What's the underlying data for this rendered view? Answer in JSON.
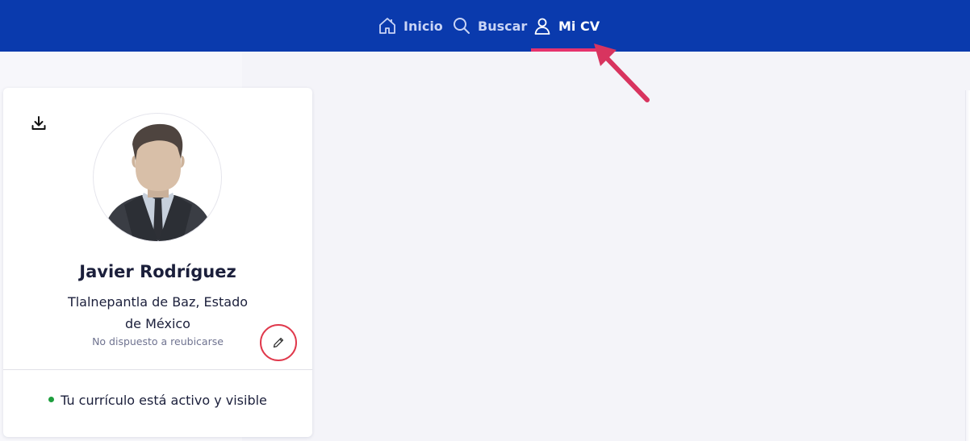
{
  "nav": {
    "items": [
      {
        "label": "Inicio",
        "icon": "home-icon",
        "active": false
      },
      {
        "label": "Buscar",
        "icon": "search-icon",
        "active": false
      },
      {
        "label": "Mi CV",
        "icon": "user-icon",
        "active": true
      }
    ]
  },
  "profile": {
    "name": "Javier Rodríguez",
    "location": "Tlalnepantla de Baz, Estado de México",
    "relocation": "No dispuesto a reubicarse",
    "status": "Tu currículo está activo y visible"
  },
  "colors": {
    "topbar": "#0a3aad",
    "active_underline": "#e6336d",
    "annotation": "#d8345f",
    "status_dot": "#1e9e3e"
  }
}
